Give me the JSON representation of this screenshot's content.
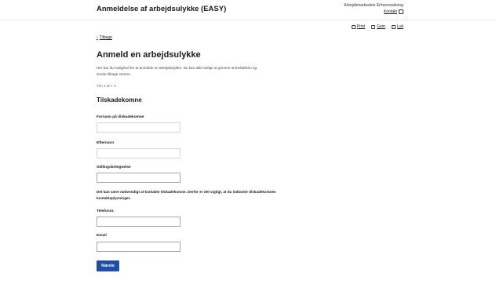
{
  "header": {
    "app_title": "Anmeldelse af arbejdsulykke (EASY)",
    "org_name": "Arbejdsmarkedets Erhvervssikring",
    "contact_label": "Kontakt"
  },
  "toolbar": {
    "print_label": "Print",
    "save_label": "Gem",
    "close_label": "Luk"
  },
  "nav": {
    "back_label": "Tilbage"
  },
  "main": {
    "title": "Anmeld en arbejdsulykke",
    "intro": "Her har du mulighed for at anmelde en arbejdsulykke. Du kan altid vælge at gemme anmeldelsen og sende tilbage senere.",
    "step_label": "Trin 2 af 7",
    "section_title": "Tilskadekomne",
    "notice": "Det kan være nødvendigt at kontakte tilskadekomne. Derfor er det vigtigt, at du indtaster tilskadekomnes kontaktoplysninger."
  },
  "form": {
    "first_name_label": "Fornavn på tilskadekomne",
    "first_name_value": "",
    "last_name_label": "Efternavn",
    "last_name_value": "",
    "job_title_label": "Stillingsbetegnelse",
    "job_title_value": "",
    "phone_label": "Telefonnr.",
    "phone_value": "",
    "email_label": "Email",
    "email_value": ""
  },
  "actions": {
    "next_label": "Næste"
  },
  "colors": {
    "primary_button": "#1f4ea3"
  }
}
